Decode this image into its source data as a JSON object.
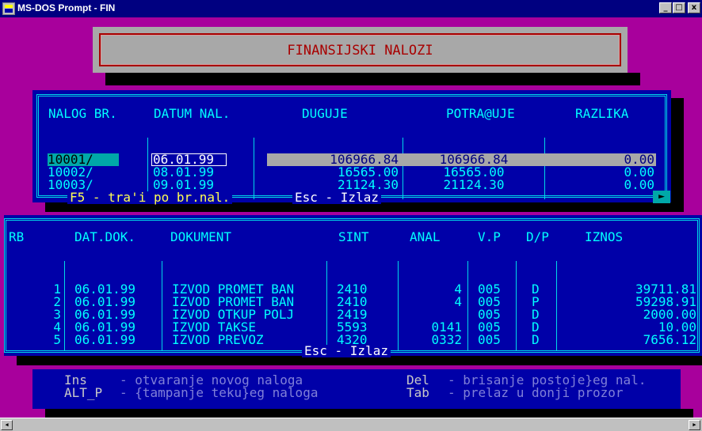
{
  "window": {
    "title": "MS-DOS Prompt - FIN",
    "minimize": "_",
    "maximize": "□",
    "close": "x"
  },
  "banner": {
    "title": "FINANSIJSKI NALOZI"
  },
  "nalozi": {
    "headers": [
      "NALOG BR.",
      "DATUM NAL.",
      "DUGUJE",
      "POTRA@UJE",
      "RAZLIKA"
    ],
    "rows": [
      [
        "10001/",
        "06.01.99",
        "106966.84",
        "106966.84",
        "0.00"
      ],
      [
        "10002/",
        "08.01.99",
        "16565.00",
        "16565.00",
        "0.00"
      ],
      [
        "10003/",
        "09.01.99",
        "21124.30",
        "21124.30",
        "0.00"
      ]
    ],
    "footer_f5": "F5 - tra'i po br.nal.",
    "footer_esc": "Esc - Izlaz",
    "arrow": "►"
  },
  "stavke": {
    "headers": [
      "RB",
      "DAT.DOK.",
      "DOKUMENT",
      "SINT",
      "ANAL",
      "V.P",
      "D/P",
      "IZNOS"
    ],
    "rows": [
      [
        "1",
        "06.01.99",
        "IZVOD PROMET BAN",
        "2410",
        "4",
        "005",
        "D",
        "39711.81"
      ],
      [
        "2",
        "06.01.99",
        "IZVOD PROMET BAN",
        "2410",
        "4",
        "005",
        "P",
        "59298.91"
      ],
      [
        "3",
        "06.01.99",
        "IZVOD OTKUP POLJ",
        "2419",
        "",
        "005",
        "D",
        "2000.00"
      ],
      [
        "4",
        "06.01.99",
        "IZVOD TAKSE",
        "5593",
        "0141",
        "005",
        "D",
        "10.00"
      ],
      [
        "5",
        "06.01.99",
        "IZVOD PREVOZ",
        "4320",
        "0332",
        "005",
        "D",
        "7656.12"
      ]
    ],
    "footer_esc": "Esc - Izlaz"
  },
  "help": {
    "ins_key": "Ins",
    "ins_text": "- otvaranje novog naloga",
    "altp_key": "ALT_P",
    "altp_text": "- {tampanje teku}eg naloga",
    "del_key": "Del",
    "del_text": "- brisanje postoje}eg nal.",
    "tab_key": "Tab",
    "tab_text": "- prelaz u donji prozor"
  },
  "colors": {
    "background": "#a8009c",
    "panel": "#0000a8",
    "frame": "#00d8e8",
    "banner_text": "#a80000"
  },
  "icons": [
    "msdos-app-icon",
    "minimize-icon",
    "maximize-icon",
    "close-icon",
    "scroll-left-icon",
    "scroll-right-icon"
  ]
}
